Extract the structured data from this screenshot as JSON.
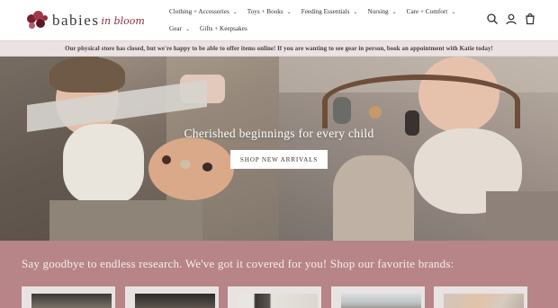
{
  "brand": {
    "logo_word": "babies",
    "logo_script": "in bloom",
    "accent": "#8c2b3a"
  },
  "nav": {
    "row1": [
      {
        "label": "Clothing + Accessories",
        "dropdown": true
      },
      {
        "label": "Toys + Books",
        "dropdown": true
      },
      {
        "label": "Feeding Essentials",
        "dropdown": true
      },
      {
        "label": "Nursing",
        "dropdown": true
      },
      {
        "label": "Care + Comfort",
        "dropdown": true
      }
    ],
    "row2": [
      {
        "label": "Gear",
        "dropdown": true
      },
      {
        "label": "Gifts + Keepsakes",
        "dropdown": false
      }
    ]
  },
  "header_icons": [
    "search-icon",
    "account-icon",
    "cart-icon"
  ],
  "announcement": "Our physical store has closed, but we're happy to be able to offer items online! If you are wanting to see gear in person, book an appointment with Katie today!",
  "hero": {
    "caption": "Cherished beginnings for every child",
    "button": "SHOP NEW ARRIVALS"
  },
  "brands": {
    "title": "Say goodbye to endless research. We've got it covered for you! Shop our favorite brands:",
    "background": "#b78587"
  }
}
